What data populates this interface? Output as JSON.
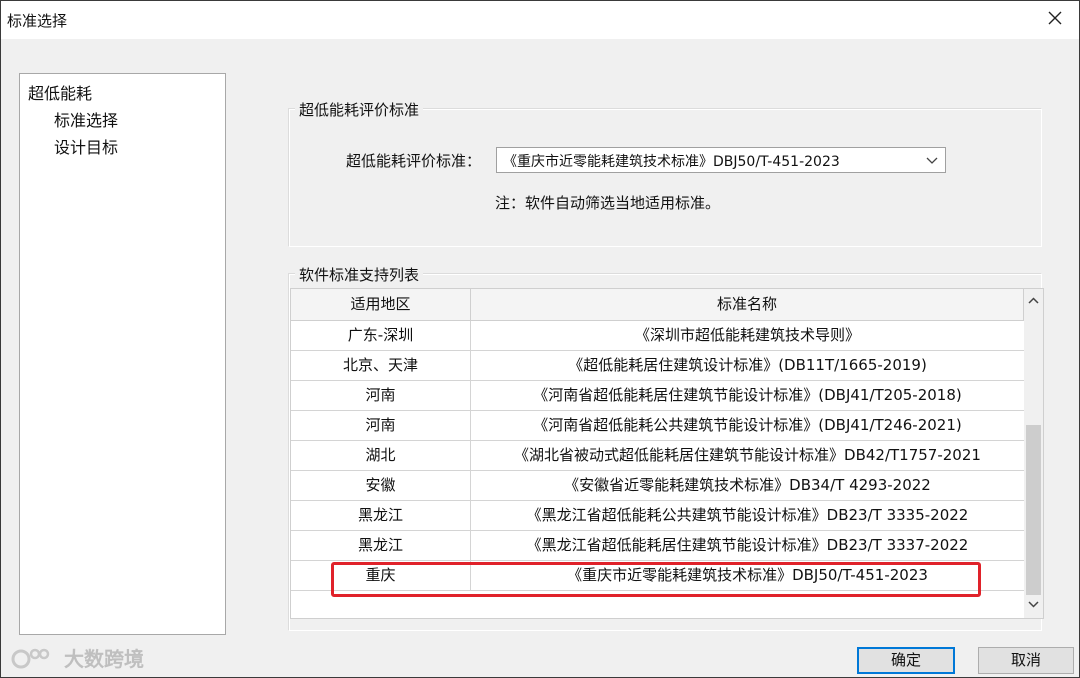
{
  "window": {
    "title": "标准选择"
  },
  "tree": {
    "items": [
      "超低能耗",
      "标准选择",
      "设计目标"
    ]
  },
  "evaluation_group": {
    "title": "超低能耗评价标准",
    "label": "超低能耗评价标准：",
    "selected": "《重庆市近零能耗建筑技术标准》DBJ50/T-451-2023",
    "note": "注：软件自动筛选当地适用标准。"
  },
  "support_group": {
    "title": "软件标准支持列表",
    "columns": [
      "适用地区",
      "标准名称"
    ],
    "rows": [
      [
        "广东-深圳",
        "《深圳市超低能耗建筑技术导则》"
      ],
      [
        "北京、天津",
        "《超低能耗居住建筑设计标准》(DB11T/1665-2019)"
      ],
      [
        "河南",
        "《河南省超低能耗居住建筑节能设计标准》(DBJ41/T205-2018)"
      ],
      [
        "河南",
        "《河南省超低能耗公共建筑节能设计标准》(DBJ41/T246-2021)"
      ],
      [
        "湖北",
        "《湖北省被动式超低能耗居住建筑节能设计标准》DB42/T1757-2021"
      ],
      [
        "安徽",
        "《安徽省近零能耗建筑技术标准》DB34/T 4293-2022"
      ],
      [
        "黑龙江",
        "《黑龙江省超低能耗公共建筑节能设计标准》DB23/T 3335-2022"
      ],
      [
        "黑龙江",
        "《黑龙江省超低能耗居住建筑节能设计标准》DB23/T 3337-2022"
      ],
      [
        "重庆",
        "《重庆市近零能耗建筑技术标准》DBJ50/T-451-2023"
      ]
    ]
  },
  "buttons": {
    "ok": "确定",
    "cancel": "取消"
  },
  "watermark": {
    "text": "大数跨境"
  },
  "colors": {
    "highlight": "#e0222a",
    "focus": "#0078d7"
  }
}
